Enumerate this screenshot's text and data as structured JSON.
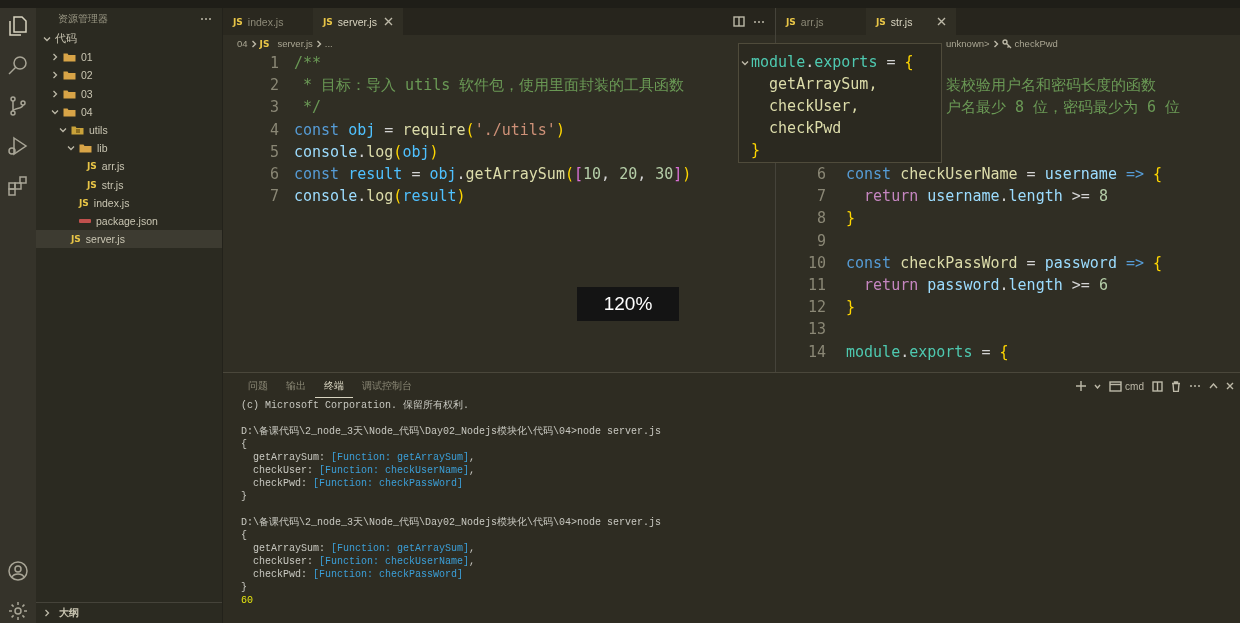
{
  "sidebar": {
    "title": "资源管理器",
    "tree": [
      {
        "label": "代码",
        "kind": "root",
        "expanded": true,
        "selected": false,
        "children": [
          {
            "label": "01",
            "kind": "folder",
            "expanded": false,
            "selected": false
          },
          {
            "label": "02",
            "kind": "folder",
            "expanded": false,
            "selected": false
          },
          {
            "label": "03",
            "kind": "folder",
            "expanded": false,
            "selected": false
          },
          {
            "label": "04",
            "kind": "folder",
            "expanded": true,
            "selected": false,
            "children": [
              {
                "label": "utils",
                "kind": "package",
                "expanded": true,
                "selected": false,
                "children": [
                  {
                    "label": "lib",
                    "kind": "folder",
                    "expanded": true,
                    "selected": false,
                    "children": [
                      {
                        "label": "arr.js",
                        "kind": "js",
                        "badge": "JS",
                        "selected": false
                      },
                      {
                        "label": "str.js",
                        "kind": "js",
                        "badge": "JS",
                        "selected": false
                      }
                    ]
                  },
                  {
                    "label": "index.js",
                    "kind": "js",
                    "badge": "JS",
                    "selected": false
                  },
                  {
                    "label": "package.json",
                    "kind": "json",
                    "selected": false
                  }
                ]
              },
              {
                "label": "server.js",
                "kind": "js",
                "badge": "JS",
                "selected": true
              }
            ]
          }
        ]
      }
    ],
    "outline": {
      "label": "大纲",
      "expanded": false
    }
  },
  "left_editor": {
    "tabs": [
      {
        "label": "index.js",
        "badge": "JS",
        "selected": false
      },
      {
        "label": "server.js",
        "badge": "JS",
        "selected": true
      }
    ],
    "breadcrumb": [
      {
        "label": "04"
      },
      {
        "label": "server.js",
        "badge": "JS"
      },
      {
        "label": "..."
      }
    ],
    "lines": [
      {
        "number": "1",
        "tokens": [
          {
            "text": "/**",
            "kind": "comment"
          }
        ]
      },
      {
        "number": "2",
        "tokens": [
          {
            "text": " * 目标：导入 utils 软件包，使用里面封装的工具函数",
            "kind": "comment"
          }
        ]
      },
      {
        "number": "3",
        "tokens": [
          {
            "text": " */",
            "kind": "comment"
          }
        ]
      },
      {
        "number": "4",
        "tokens": [
          {
            "text": "const ",
            "kind": "keyword"
          },
          {
            "text": "obj",
            "kind": "const"
          },
          {
            "text": " = ",
            "kind": "punct"
          },
          {
            "text": "require",
            "kind": "function"
          },
          {
            "text": "(",
            "kind": "bracket"
          },
          {
            "text": "'./utils'",
            "kind": "string"
          },
          {
            "text": ")",
            "kind": "bracket"
          }
        ]
      },
      {
        "number": "5",
        "tokens": [
          {
            "text": "console",
            "kind": "variable"
          },
          {
            "text": ".",
            "kind": "punct"
          },
          {
            "text": "log",
            "kind": "function"
          },
          {
            "text": "(",
            "kind": "bracket"
          },
          {
            "text": "obj",
            "kind": "const"
          },
          {
            "text": ")",
            "kind": "bracket"
          }
        ]
      },
      {
        "number": "6",
        "tokens": [
          {
            "text": "const ",
            "kind": "keyword"
          },
          {
            "text": "result",
            "kind": "const"
          },
          {
            "text": " = ",
            "kind": "punct"
          },
          {
            "text": "obj",
            "kind": "const"
          },
          {
            "text": ".",
            "kind": "punct"
          },
          {
            "text": "getArraySum",
            "kind": "function"
          },
          {
            "text": "(",
            "kind": "bracket"
          },
          {
            "text": "[",
            "kind": "bracket2"
          },
          {
            "text": "10",
            "kind": "number"
          },
          {
            "text": ", ",
            "kind": "punct"
          },
          {
            "text": "20",
            "kind": "number"
          },
          {
            "text": ", ",
            "kind": "punct"
          },
          {
            "text": "30",
            "kind": "number"
          },
          {
            "text": "]",
            "kind": "bracket2"
          },
          {
            "text": ")",
            "kind": "bracket"
          }
        ]
      },
      {
        "number": "7",
        "tokens": [
          {
            "text": "console",
            "kind": "variable"
          },
          {
            "text": ".",
            "kind": "punct"
          },
          {
            "text": "log",
            "kind": "function"
          },
          {
            "text": "(",
            "kind": "bracket"
          },
          {
            "text": "result",
            "kind": "const"
          },
          {
            "text": ")",
            "kind": "bracket"
          }
        ]
      }
    ]
  },
  "right_editor": {
    "tabs": [
      {
        "label": "arr.js",
        "badge": "JS",
        "selected": false
      },
      {
        "label": "str.js",
        "badge": "JS",
        "selected": true
      }
    ],
    "breadcrumb": [
      {
        "label": "unknown>",
        "kind": "plain"
      },
      {
        "label": "checkPwd",
        "kind": "symbol"
      }
    ],
    "partial_comments": [
      "装校验用户名和密码长度的函数",
      "户名最少 8 位，密码最少为 6 位"
    ],
    "lines": [
      {
        "number": "6",
        "tokens": [
          {
            "text": "const ",
            "kind": "keyword"
          },
          {
            "text": "checkUserName",
            "kind": "function"
          },
          {
            "text": " = ",
            "kind": "punct"
          },
          {
            "text": "username",
            "kind": "variable"
          },
          {
            "text": " => ",
            "kind": "keyword"
          },
          {
            "text": "{",
            "kind": "bracket"
          }
        ]
      },
      {
        "number": "7",
        "tokens": [
          {
            "text": "  return",
            "kind": "control"
          },
          {
            "text": " username",
            "kind": "variable"
          },
          {
            "text": ".",
            "kind": "punct"
          },
          {
            "text": "length",
            "kind": "variable"
          },
          {
            "text": " >= ",
            "kind": "punct"
          },
          {
            "text": "8",
            "kind": "number"
          }
        ]
      },
      {
        "number": "8",
        "tokens": [
          {
            "text": "}",
            "kind": "bracket"
          }
        ]
      },
      {
        "number": "9"
      },
      {
        "number": "10",
        "tokens": [
          {
            "text": "const ",
            "kind": "keyword"
          },
          {
            "text": "checkPassWord",
            "kind": "function"
          },
          {
            "text": " = ",
            "kind": "punct"
          },
          {
            "text": "password",
            "kind": "variable"
          },
          {
            "text": " => ",
            "kind": "keyword"
          },
          {
            "text": "{",
            "kind": "bracket"
          }
        ]
      },
      {
        "number": "11",
        "tokens": [
          {
            "text": "  return",
            "kind": "control"
          },
          {
            "text": " password",
            "kind": "variable"
          },
          {
            "text": ".",
            "kind": "punct"
          },
          {
            "text": "length",
            "kind": "variable"
          },
          {
            "text": " >= ",
            "kind": "punct"
          },
          {
            "text": "6",
            "kind": "number"
          }
        ]
      },
      {
        "number": "12",
        "tokens": [
          {
            "text": "}",
            "kind": "bracket"
          }
        ]
      },
      {
        "number": "13"
      },
      {
        "number": "14",
        "tokens": [
          {
            "text": "module",
            "kind": "type"
          },
          {
            "text": ".",
            "kind": "punct"
          },
          {
            "text": "exports",
            "kind": "type"
          },
          {
            "text": " = ",
            "kind": "punct"
          },
          {
            "text": "{",
            "kind": "bracket"
          }
        ]
      }
    ]
  },
  "hover": {
    "lines": [
      {
        "tokens": [
          {
            "text": "module",
            "kind": "type"
          },
          {
            "text": ".",
            "kind": "punct"
          },
          {
            "text": "exports",
            "kind": "type"
          },
          {
            "text": " = ",
            "kind": "punct"
          },
          {
            "text": "{",
            "kind": "bracket"
          }
        ]
      },
      {
        "tokens": [
          {
            "text": "  getArraySum,",
            "kind": "function"
          }
        ]
      },
      {
        "tokens": [
          {
            "text": "  checkUser,",
            "kind": "function"
          }
        ]
      },
      {
        "tokens": [
          {
            "text": "  checkPwd",
            "kind": "function"
          }
        ]
      },
      {
        "tokens": [
          {
            "text": "}",
            "kind": "bracket"
          }
        ]
      }
    ]
  },
  "zoom_indicator": "120%",
  "panel": {
    "tabs": [
      {
        "label": "问题",
        "selected": false
      },
      {
        "label": "输出",
        "selected": false
      },
      {
        "label": "终端",
        "selected": true
      },
      {
        "label": "调试控制台",
        "selected": false
      }
    ],
    "terminal_name": "cmd",
    "lines": [
      {
        "tokens": [
          {
            "text": "(c) Microsoft Corporation. 保留所有权利.",
            "kind": "text"
          }
        ]
      },
      {
        "blank": true
      },
      {
        "tokens": [
          {
            "text": "D:\\备课代码\\2_node_3天\\Node_代码\\Day02_Nodejs模块化\\代码\\04>node server.js",
            "kind": "text"
          }
        ]
      },
      {
        "tokens": [
          {
            "text": "{",
            "kind": "text"
          }
        ]
      },
      {
        "tokens": [
          {
            "text": "  getArraySum: ",
            "kind": "text"
          },
          {
            "text": "[Function: getArraySum]",
            "kind": "fn"
          },
          {
            "text": ",",
            "kind": "text"
          }
        ]
      },
      {
        "tokens": [
          {
            "text": "  checkUser: ",
            "kind": "text"
          },
          {
            "text": "[Function: checkUserName]",
            "kind": "fn"
          },
          {
            "text": ",",
            "kind": "text"
          }
        ]
      },
      {
        "tokens": [
          {
            "text": "  checkPwd: ",
            "kind": "text"
          },
          {
            "text": "[Function: checkPassWord]",
            "kind": "fn"
          }
        ]
      },
      {
        "tokens": [
          {
            "text": "}",
            "kind": "text"
          }
        ]
      },
      {
        "blank": true
      },
      {
        "tokens": [
          {
            "text": "D:\\备课代码\\2_node_3天\\Node_代码\\Day02_Nodejs模块化\\代码\\04>node server.js",
            "kind": "text"
          }
        ]
      },
      {
        "tokens": [
          {
            "text": "{",
            "kind": "text"
          }
        ]
      },
      {
        "tokens": [
          {
            "text": "  getArraySum: ",
            "kind": "text"
          },
          {
            "text": "[Function: getArraySum]",
            "kind": "fn"
          },
          {
            "text": ",",
            "kind": "text"
          }
        ]
      },
      {
        "tokens": [
          {
            "text": "  checkUser: ",
            "kind": "text"
          },
          {
            "text": "[Function: checkUserName]",
            "kind": "fn"
          },
          {
            "text": ",",
            "kind": "text"
          }
        ]
      },
      {
        "tokens": [
          {
            "text": "  checkPwd: ",
            "kind": "text"
          },
          {
            "text": "[Function: checkPassWord]",
            "kind": "fn"
          }
        ]
      },
      {
        "tokens": [
          {
            "text": "}",
            "kind": "text"
          }
        ]
      },
      {
        "tokens": [
          {
            "text": "60",
            "kind": "number"
          }
        ]
      }
    ]
  }
}
